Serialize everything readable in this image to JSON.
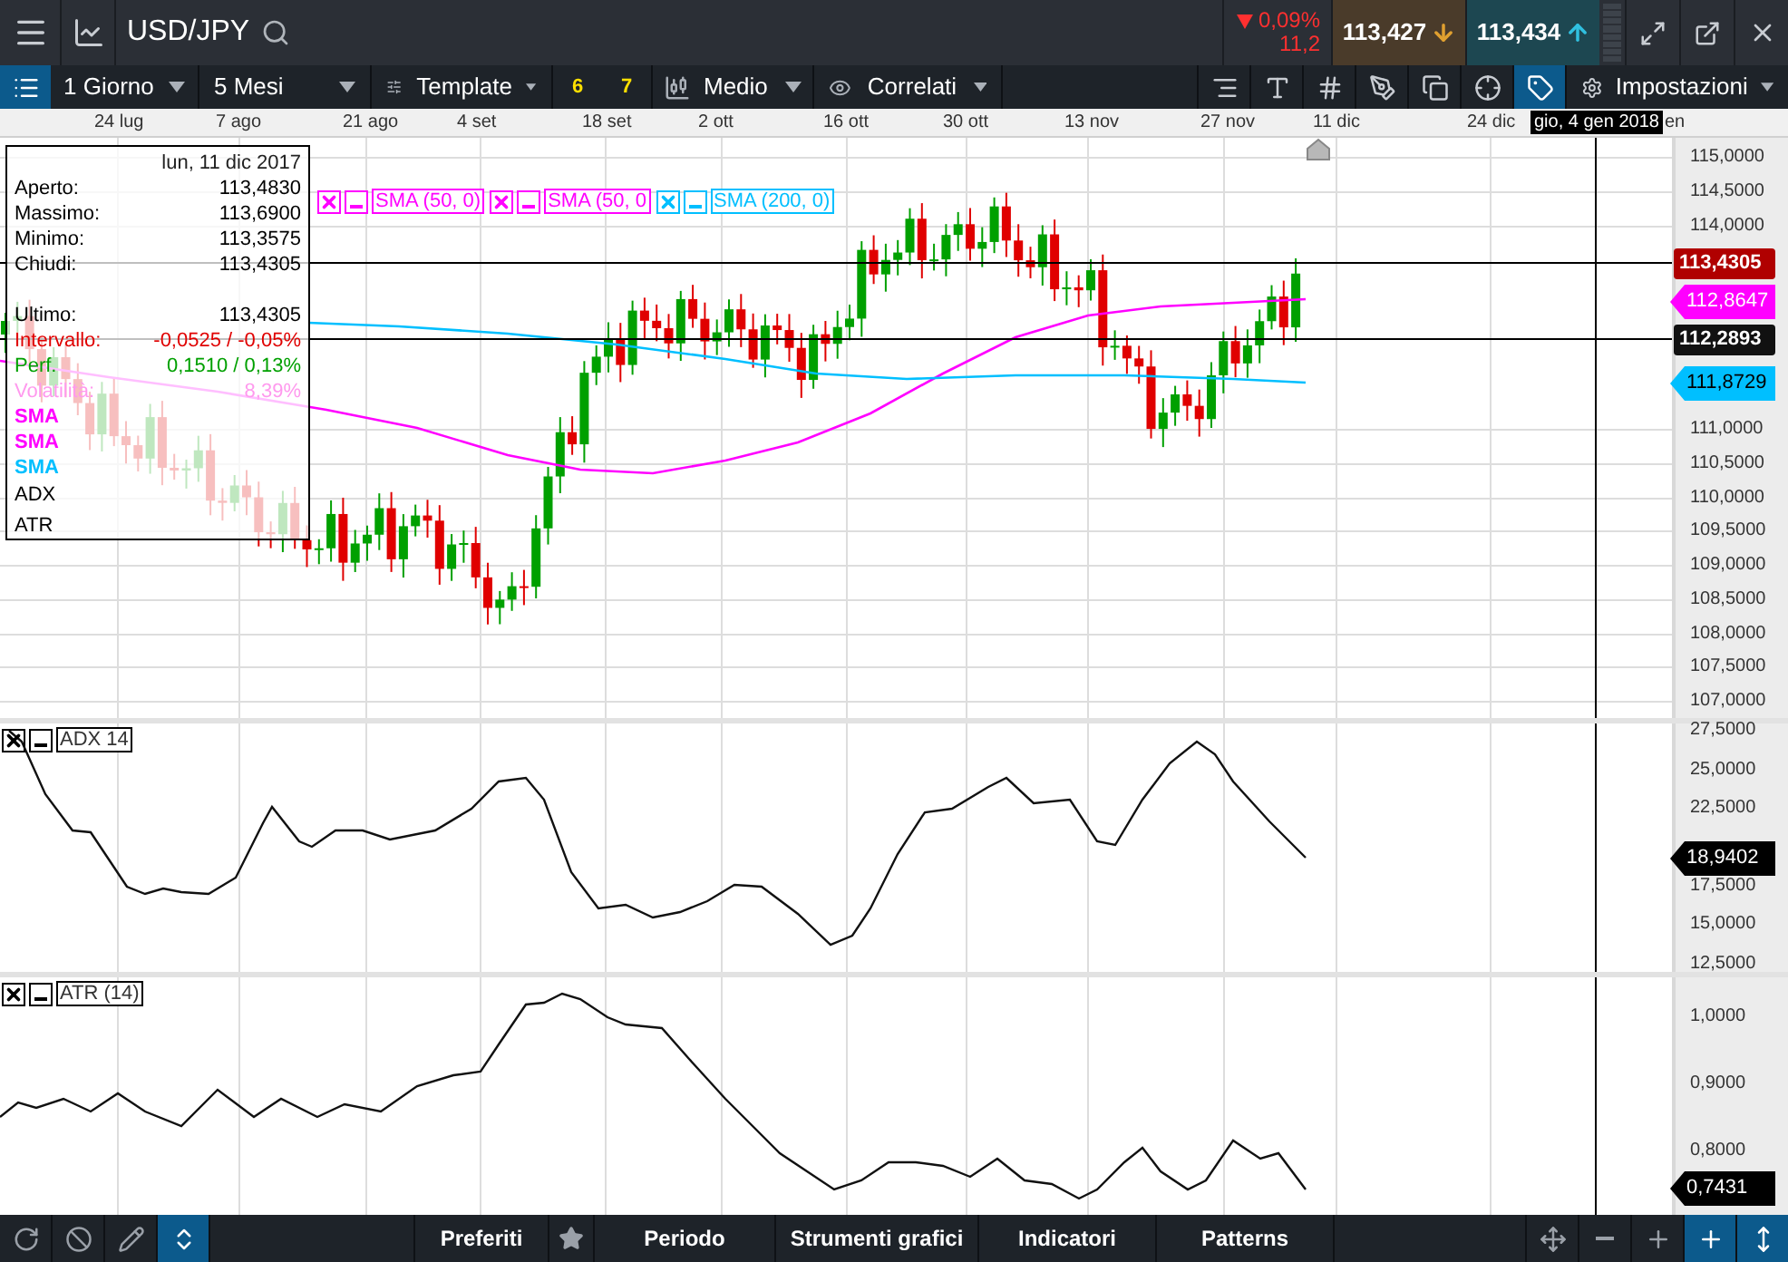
{
  "header": {
    "symbol": "USD/JPY",
    "change": {
      "falling": true,
      "percent": "0,09%",
      "points": "11,2"
    },
    "sell": {
      "price": "113,427",
      "falling": true
    },
    "buy": {
      "price": "113,434",
      "falling": false
    }
  },
  "toolbar": {
    "interval": "1 Giorno",
    "range": "5 Mesi",
    "template": "Template",
    "counts": [
      "6",
      "7"
    ],
    "chart_type": "Medio",
    "correlated": "Correlati",
    "settings": "Impostazioni",
    "tools": [
      {
        "kind": "scale",
        "active": false
      },
      {
        "kind": "text-size",
        "active": false
      },
      {
        "kind": "grid",
        "active": false
      },
      {
        "kind": "draw",
        "active": false
      },
      {
        "kind": "copy",
        "active": false
      },
      {
        "kind": "crosshair",
        "active": false
      },
      {
        "kind": "label",
        "active": true
      }
    ]
  },
  "date_axis": {
    "labels": [
      "24 lug",
      "7 ago",
      "21 ago",
      "4 set",
      "18 set",
      "2 ott",
      "16 ott",
      "30 ott",
      "13 nov",
      "27 nov",
      "11 dic",
      "24 dic"
    ],
    "cursor_label": "gio, 4 gen 2018",
    "cut_label": "en"
  },
  "price_panel": {
    "legend": [
      {
        "label": "SMA (50, 0)",
        "color": "#ff00ff"
      },
      {
        "label": "SMA (50, 0",
        "color": "#ff00ff"
      },
      {
        "label": "SMA (200, 0)",
        "color": "#00bfff"
      }
    ],
    "axis_labels": [
      "115,0000",
      "114,5000",
      "114,0000",
      "111,0000",
      "110,5000",
      "110,0000",
      "109,5000",
      "109,0000",
      "108,5000",
      "108,0000",
      "107,5000",
      "107,0000"
    ],
    "price_tags": [
      {
        "value": "113,4305",
        "color": "#b00000",
        "kind": "box"
      },
      {
        "value": "112,8647",
        "color": "#ff00ff",
        "kind": "arrow"
      },
      {
        "value": "112,2893",
        "color": "#111111",
        "kind": "box"
      },
      {
        "value": "111,8729",
        "color": "#00bfff",
        "kind": "arrow"
      }
    ]
  },
  "info_box": {
    "date": "lun, 11 dic 2017",
    "ohlc": [
      {
        "label": "Aperto:",
        "value": "113,4830",
        "color": "#000000"
      },
      {
        "label": "Massimo:",
        "value": "113,6900",
        "color": "#000000"
      },
      {
        "label": "Minimo:",
        "value": "113,3575",
        "color": "#000000"
      },
      {
        "label": "Chiudi:",
        "value": "113,4305",
        "color": "#000000"
      }
    ],
    "stats": [
      {
        "label": "Ultimo:",
        "value": "113,4305",
        "color": "#000000"
      },
      {
        "label": "Intervallo:",
        "value": "-0,0525 / -0,05%",
        "color": "#e00000"
      },
      {
        "label": "Perf.",
        "value": "0,1510 / 0,13%",
        "color": "#00a000"
      },
      {
        "label": "Volatilità:",
        "value": "8,39%",
        "color": "#ff99ee"
      }
    ],
    "indicators": [
      {
        "label": "SMA",
        "color": "#ff00ff"
      },
      {
        "label": "SMA",
        "color": "#ff00ff"
      },
      {
        "label": "SMA",
        "color": "#00bfff"
      },
      {
        "label": "ADX",
        "color": "#000000"
      },
      {
        "label": "ATR",
        "color": "#000000"
      }
    ]
  },
  "adx_panel": {
    "legend": "ADX 14",
    "axis_labels": [
      "27,5000",
      "25,0000",
      "22,5000",
      "17,5000",
      "15,0000",
      "12,5000"
    ],
    "tag": "18,9402"
  },
  "atr_panel": {
    "legend": "ATR (14)",
    "axis_labels": [
      "1,0000",
      "0,9000",
      "0,8000"
    ],
    "tag": "0,7431"
  },
  "bottom_bar": {
    "left_tools": [
      {
        "kind": "refresh",
        "active": false
      },
      {
        "kind": "ban",
        "active": false
      },
      {
        "kind": "pencil",
        "active": false
      },
      {
        "kind": "updown",
        "active": true
      }
    ],
    "menus": [
      "Preferiti",
      "Periodo",
      "Strumenti grafici",
      "Indicatori",
      "Patterns"
    ],
    "right_tools": [
      {
        "kind": "move",
        "active": false
      },
      {
        "kind": "minus",
        "active": false
      },
      {
        "kind": "plus",
        "active": false
      },
      {
        "kind": "crosshair",
        "active": true
      },
      {
        "kind": "fit",
        "active": true
      }
    ]
  }
}
